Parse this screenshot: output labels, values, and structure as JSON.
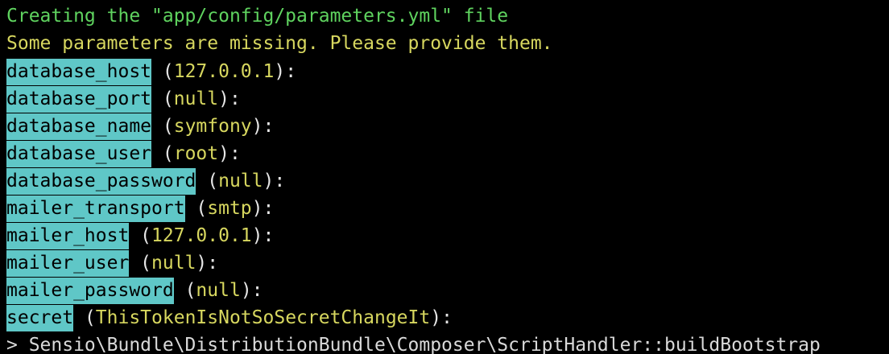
{
  "terminal": {
    "line1": "Creating the \"app/config/parameters.yml\" file",
    "line2": "Some parameters are missing. Please provide them.",
    "prompts": [
      {
        "key": "database_host",
        "default": "127.0.0.1"
      },
      {
        "key": "database_port",
        "default": "null"
      },
      {
        "key": "database_name",
        "default": "symfony"
      },
      {
        "key": "database_user",
        "default": "root"
      },
      {
        "key": "database_password",
        "default": "null"
      },
      {
        "key": "mailer_transport",
        "default": "smtp"
      },
      {
        "key": "mailer_host",
        "default": "127.0.0.1"
      },
      {
        "key": "mailer_user",
        "default": "null"
      },
      {
        "key": "mailer_password",
        "default": "null"
      },
      {
        "key": "secret",
        "default": "ThisTokenIsNotSoSecretChangeIt"
      }
    ],
    "open_paren": " (",
    "close_suffix": "):",
    "command": "> Sensio\\Bundle\\DistributionBundle\\Composer\\ScriptHandler::buildBootstrap"
  },
  "colors": {
    "background": "#000000",
    "green_text": "#5fd35f",
    "yellow_text": "#d7d75f",
    "key_highlight": "#5fc7c7"
  }
}
